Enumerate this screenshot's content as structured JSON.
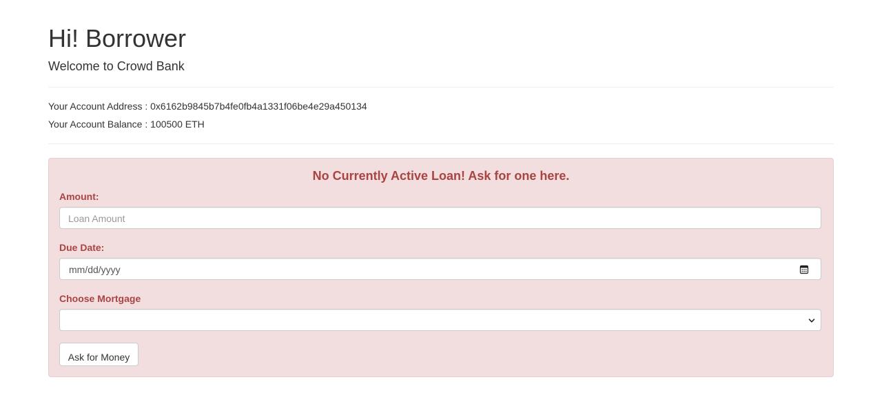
{
  "header": {
    "title": "Hi! Borrower",
    "subtitle": "Welcome to Crowd Bank"
  },
  "account": {
    "address_label": "Your Account Address :",
    "address_value": "0x6162b9845b7b4fe0fb4a1331f06be4e29a450134",
    "balance_label": "Your Account Balance :",
    "balance_value": "100500 ETH"
  },
  "loan_form": {
    "heading": "No Currently Active Loan! Ask for one here.",
    "amount_label": "Amount:",
    "amount_placeholder": "Loan Amount",
    "amount_value": "",
    "due_date_label": "Due Date:",
    "due_date_placeholder": "mm/dd/yyyy",
    "mortgage_label": "Choose Mortgage",
    "mortgage_selected": "",
    "submit_label": "Ask for Money",
    "icons": {
      "date": "calendar-icon",
      "select": "chevron-down-icon"
    }
  },
  "colors": {
    "alert_background": "#f2dede",
    "alert_border": "#ebccd1",
    "alert_text": "#a94442",
    "body_text": "#333333"
  }
}
